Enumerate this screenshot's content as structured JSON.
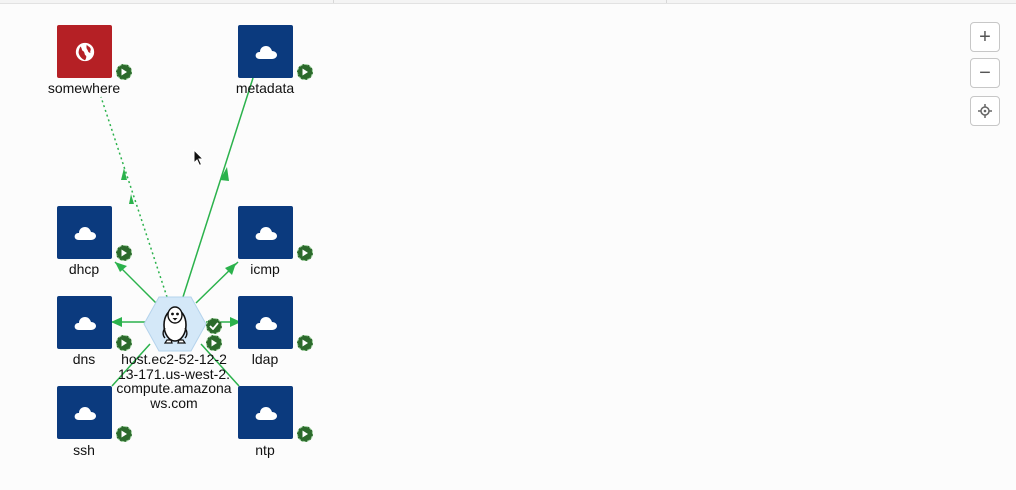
{
  "nodes": {
    "somewhere": {
      "label": "somewhere",
      "icon": "globe-icon",
      "color": "#b52025"
    },
    "metadata": {
      "label": "metadata",
      "icon": "cloud-icon",
      "color": "#0b3a7e"
    },
    "dhcp": {
      "label": "dhcp",
      "icon": "cloud-icon",
      "color": "#0b3a7e"
    },
    "icmp": {
      "label": "icmp",
      "icon": "cloud-icon",
      "color": "#0b3a7e"
    },
    "dns": {
      "label": "dns",
      "icon": "cloud-icon",
      "color": "#0b3a7e"
    },
    "ldap": {
      "label": "ldap",
      "icon": "cloud-icon",
      "color": "#0b3a7e"
    },
    "ssh": {
      "label": "ssh",
      "icon": "cloud-icon",
      "color": "#0b3a7e"
    },
    "ntp": {
      "label": "ntp",
      "icon": "cloud-icon",
      "color": "#0b3a7e"
    }
  },
  "host": {
    "label_lines": [
      "host.ec2-52-12-2",
      "13-171.us-west-2.",
      "compute.amazona",
      "ws.com"
    ],
    "icon": "linux-penguin-icon",
    "status_icon": "check-badge-icon"
  },
  "badge_icon": "play-badge-icon",
  "zoom_controls": {
    "zoom_in": "+",
    "zoom_out": "−",
    "recenter_icon": "crosshair-icon"
  },
  "colors": {
    "edge": "#2bb24c",
    "badge": "#2c6a2c",
    "host_fill": "#d4e8f8",
    "node_blue": "#0b3a7e",
    "node_red": "#b52025"
  }
}
